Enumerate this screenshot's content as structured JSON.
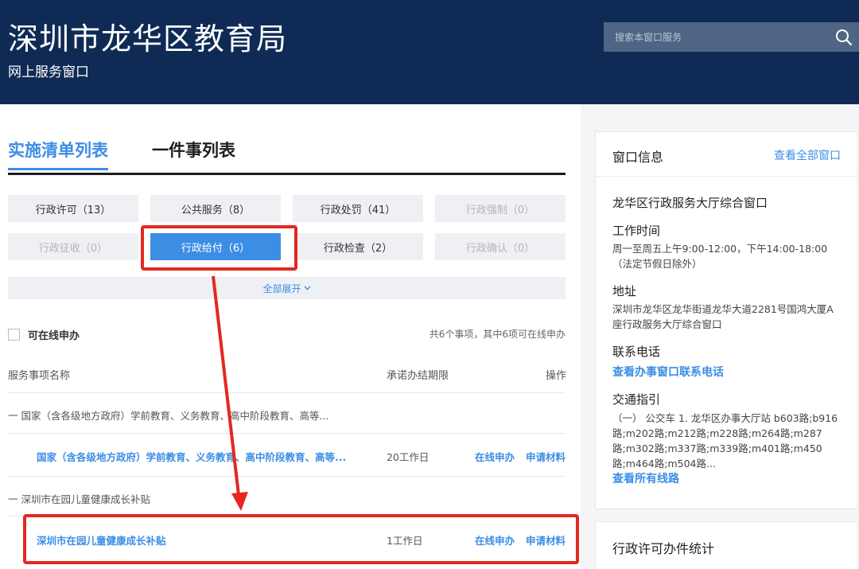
{
  "header": {
    "title": "深圳市龙华区教育局",
    "subtitle": "网上服务窗口",
    "search_placeholder": "搜索本窗口服务",
    "search_icon": "search-icon"
  },
  "tabs": [
    {
      "label": "实施清单列表",
      "active": true
    },
    {
      "label": "一件事列表",
      "active": false
    }
  ],
  "categories": [
    {
      "label": "行政许可（13）",
      "state": "normal"
    },
    {
      "label": "公共服务（8）",
      "state": "normal"
    },
    {
      "label": "行政处罚（41）",
      "state": "normal"
    },
    {
      "label": "行政强制（0）",
      "state": "disabled"
    },
    {
      "label": "行政征收（0）",
      "state": "disabled"
    },
    {
      "label": "行政给付（6）",
      "state": "active"
    },
    {
      "label": "行政检查（2）",
      "state": "normal"
    },
    {
      "label": "行政确认（0）",
      "state": "disabled"
    }
  ],
  "expand_all": "全部展开",
  "filter": {
    "label": "可在线申办",
    "checked": false
  },
  "summary": "共6个事项，其中6项可在线申办",
  "table": {
    "headers": {
      "name": "服务事项名称",
      "deadline": "承诺办结期限",
      "action": "操作"
    },
    "groups": [
      {
        "label": "一  国家（含各级地方政府）学前教育、义务教育、高中阶段教育、高等...",
        "rows": [
          {
            "name": "国家（含各级地方政府）学前教育、义务教育、高中阶段教育、高等...",
            "deadline": "20工作日",
            "online": "在线申办",
            "materials": "申请材料"
          }
        ]
      },
      {
        "label": "一  深圳市在园儿童健康成长补贴",
        "rows": [
          {
            "name": "深圳市在园儿童健康成长补贴",
            "deadline": "1工作日",
            "online": "在线申办",
            "materials": "申请材料"
          }
        ]
      }
    ]
  },
  "window_info": {
    "title": "窗口信息",
    "view_all": "查看全部窗口",
    "window_name": "龙华区行政服务大厅综合窗口",
    "hours_label": "工作时间",
    "hours": "周一至周五上午9:00-12:00，下午14:00-18:00（法定节假日除外）",
    "address_label": "地址",
    "address": "深圳市龙华区龙华街道龙华大道2281号国鸿大厦A座行政服务大厅综合窗口",
    "phone_label": "联系电话",
    "phone_link": "查看办事窗口联系电话",
    "traffic_label": "交通指引",
    "traffic": "（一） 公交车 1. 龙华区办事大厅站 b603路;b916路;m202路;m212路;m228路;m264路;m287路;m302路;m337路;m339路;m401路;m450路;m464路;m504路...",
    "routes_link": "查看所有线路"
  },
  "stats": {
    "title": "行政许可办件统计"
  },
  "colors": {
    "header_bg": "#0f2b55",
    "accent": "#3c8ee5",
    "annotation": "#e32820"
  }
}
